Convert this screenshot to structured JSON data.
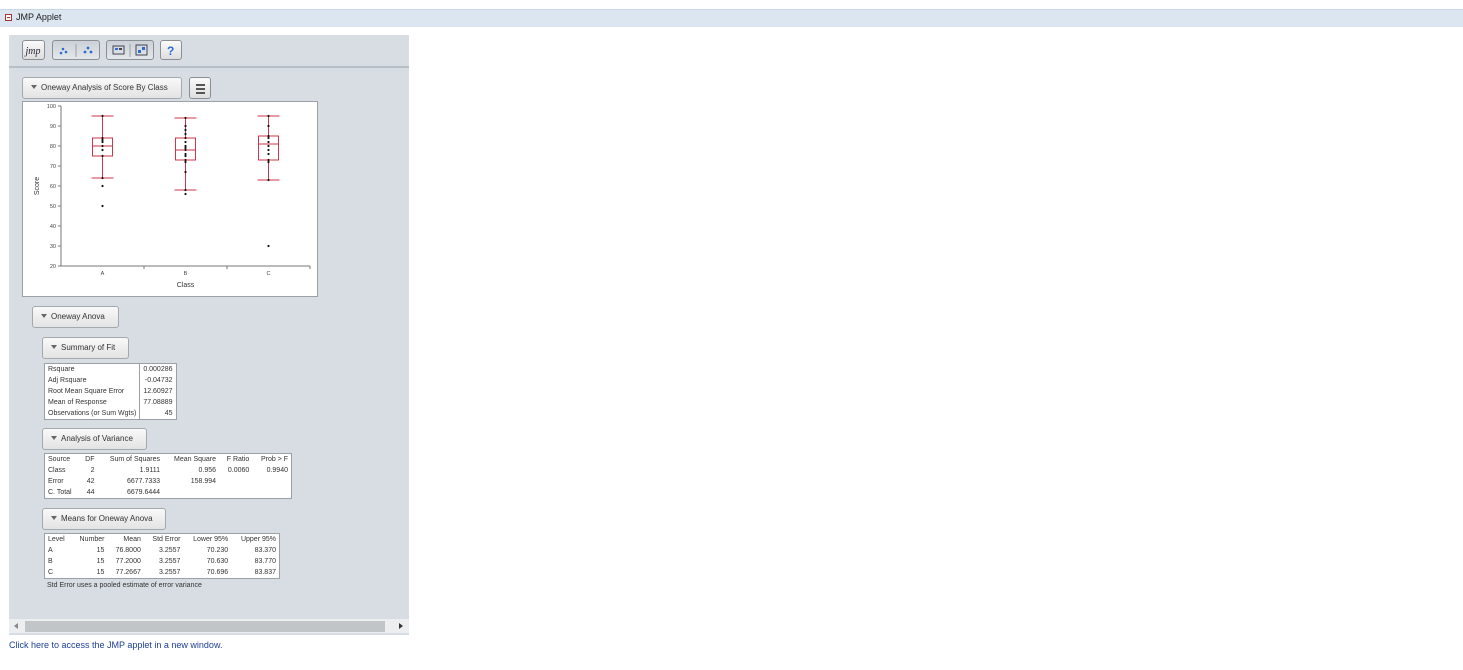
{
  "applet": {
    "title": "JMP Applet",
    "link_text": "Click here to access the JMP applet in a new window."
  },
  "toolbar": {
    "buttons": [
      {
        "icon": "jmp-logo-icon",
        "label": "jmp"
      },
      {
        "icon": "points-icon"
      },
      {
        "icon": "points-alt-icon"
      },
      {
        "icon": "flag-icon"
      },
      {
        "icon": "grid-icon"
      },
      {
        "icon": "help-icon",
        "label": "?"
      }
    ]
  },
  "report": {
    "title": "Oneway Analysis of Score By Class",
    "anova_title": "Oneway Anova",
    "summary": {
      "title": "Summary of Fit",
      "rows": [
        {
          "label": "Rsquare",
          "value": "0.000286"
        },
        {
          "label": "Adj Rsquare",
          "value": "-0.04732"
        },
        {
          "label": "Root Mean Square Error",
          "value": "12.60927"
        },
        {
          "label": "Mean of Response",
          "value": "77.08889"
        },
        {
          "label": "Observations (or Sum Wgts)",
          "value": "45"
        }
      ]
    },
    "variance": {
      "title": "Analysis of Variance",
      "headers": [
        "Source",
        "DF",
        "Sum of Squares",
        "Mean Square",
        "F Ratio",
        "Prob > F"
      ],
      "rows": [
        [
          "Class",
          "2",
          "1.9111",
          "0.956",
          "0.0060",
          "0.9940"
        ],
        [
          "Error",
          "42",
          "6677.7333",
          "158.994",
          "",
          ""
        ],
        [
          "C. Total",
          "44",
          "6679.6444",
          "",
          "",
          ""
        ]
      ]
    },
    "means": {
      "title": "Means for Oneway Anova",
      "headers": [
        "Level",
        "Number",
        "Mean",
        "Std Error",
        "Lower 95%",
        "Upper 95%"
      ],
      "rows": [
        [
          "A",
          "15",
          "76.8000",
          "3.2557",
          "70.230",
          "83.370"
        ],
        [
          "B",
          "15",
          "77.2000",
          "3.2557",
          "70.630",
          "83.770"
        ],
        [
          "C",
          "15",
          "77.2667",
          "3.2557",
          "70.696",
          "83.837"
        ]
      ],
      "note": "Std Error uses a pooled estimate of error variance"
    }
  },
  "chart_data": {
    "type": "scatter",
    "title": "",
    "xlabel": "Class",
    "ylabel": "Score",
    "categories": [
      "A",
      "B",
      "C"
    ],
    "ylim": [
      20,
      100
    ],
    "yticks": [
      20,
      30,
      40,
      50,
      60,
      70,
      80,
      90,
      100
    ],
    "grid": false,
    "box_color": "#d2344a",
    "boxes": [
      {
        "category": "A",
        "whisker_low": 64,
        "q1": 75,
        "median": 80,
        "q3": 84,
        "whisker_high": 95
      },
      {
        "category": "B",
        "whisker_low": 58,
        "q1": 73,
        "median": 78,
        "q3": 84,
        "whisker_high": 94
      },
      {
        "category": "C",
        "whisker_low": 63,
        "q1": 73,
        "median": 81,
        "q3": 85,
        "whisker_high": 95
      }
    ],
    "points": [
      {
        "category": "A",
        "values": [
          50,
          60,
          64,
          75,
          78,
          80,
          82,
          83,
          84,
          95
        ]
      },
      {
        "category": "B",
        "values": [
          56,
          58,
          67,
          72,
          73,
          75,
          76,
          78,
          79,
          80,
          82,
          84,
          86,
          88,
          90,
          94
        ]
      },
      {
        "category": "C",
        "values": [
          30,
          63,
          72,
          73,
          76,
          78,
          80,
          82,
          84,
          85,
          90,
          95
        ]
      }
    ]
  }
}
